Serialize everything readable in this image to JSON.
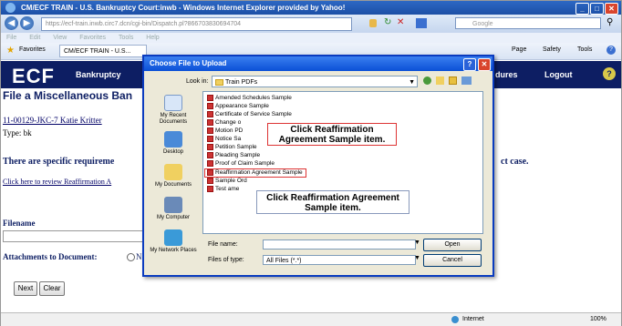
{
  "window": {
    "title": "CM/ECF TRAIN - U.S. Bankruptcy Court:inwb - Windows Internet Explorer provided by Yahoo!",
    "url": "https://ecf-train.inwb.circ7.dcn/cgi-bin/Dispatch.pl?866703830694704",
    "search_placeholder": "Google",
    "menu": [
      "File",
      "Edit",
      "View",
      "Favorites",
      "Tools",
      "Help"
    ],
    "favorites_label": "Favorites",
    "tab_label": "CM/ECF TRAIN - U.S...",
    "toolbar": [
      "Page",
      "Safety",
      "Tools"
    ],
    "status_zone": "Internet",
    "zoom": "100%"
  },
  "ecf": {
    "logo": "ECF",
    "menu_bankruptcy": "Bankruptcy",
    "menu_procedures": "dures",
    "menu_logout": "Logout"
  },
  "page": {
    "heading": "File a Miscellaneous Ban",
    "case_link": "11-00129-JKC-7 Katie Kritter",
    "type_line": "Type: bk",
    "requirements_text": "There are specific requireme",
    "requirements_suffix": "ct case.",
    "review_link": "Click here to review Reaffirmation A",
    "filename_label": "Filename",
    "attachments_label": "Attachments to Document:",
    "next_button": "Next",
    "clear_button": "Clear"
  },
  "dialog": {
    "title": "Choose File to Upload",
    "look_in_label": "Look in:",
    "look_in_value": "Train PDFs",
    "places": [
      "My Recent Documents",
      "Desktop",
      "My Documents",
      "My Computer",
      "My Network Places"
    ],
    "files": [
      "Amended Schedules Sample",
      "Appearance Sample",
      "Certificate of Service Sample",
      "Change o",
      "Motion PD",
      "Notice Sa",
      "Petition Sample",
      "Pleading Sample",
      "Proof of Claim Sample",
      "Reaffirmation Agreement Sample",
      "Sample Ord",
      "Test ame"
    ],
    "file_name_label": "File name:",
    "file_name_value": "",
    "files_of_type_label": "Files of type:",
    "files_of_type_value": "All Files (*.*)",
    "open_button": "Open",
    "cancel_button": "Cancel"
  },
  "callouts": {
    "top": "Click Reaffirmation Agreement Sample item.",
    "bottom": "Click Reaffirmation Agreement Sample item."
  }
}
